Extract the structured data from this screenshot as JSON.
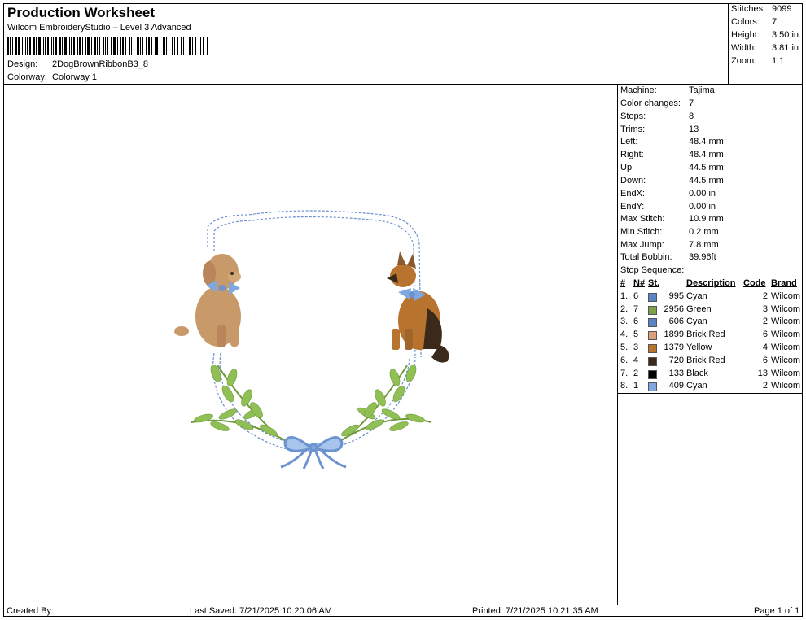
{
  "header": {
    "title": "Production Worksheet",
    "software": "Wilcom EmbroideryStudio – Level 3 Advanced",
    "design_label": "Design:",
    "design_value": "2DogBrownRibbonB3_8",
    "colorway_label": "Colorway:",
    "colorway_value": "Colorway 1"
  },
  "summary": [
    {
      "label": "Stitches:",
      "value": "9099"
    },
    {
      "label": "Colors:",
      "value": "7"
    },
    {
      "label": "Height:",
      "value": "3.50 in"
    },
    {
      "label": "Width:",
      "value": "3.81 in"
    },
    {
      "label": "Zoom:",
      "value": "1:1"
    }
  ],
  "machine_info": [
    {
      "label": "Machine:",
      "value": "Tajima"
    },
    {
      "label": "Color changes:",
      "value": "7"
    },
    {
      "label": "Stops:",
      "value": "8"
    },
    {
      "label": "Trims:",
      "value": "13"
    },
    {
      "label": "Left:",
      "value": "48.4 mm"
    },
    {
      "label": "Right:",
      "value": "48.4 mm"
    },
    {
      "label": "Up:",
      "value": "44.5 mm"
    },
    {
      "label": "Down:",
      "value": "44.5 mm"
    },
    {
      "label": "EndX:",
      "value": "0.00 in"
    },
    {
      "label": "EndY:",
      "value": "0.00 in"
    },
    {
      "label": "Max Stitch:",
      "value": "10.9 mm"
    },
    {
      "label": "Min Stitch:",
      "value": "0.2 mm"
    },
    {
      "label": "Max Jump:",
      "value": "7.8 mm"
    },
    {
      "label": "Total Bobbin:",
      "value": "39.96ft"
    }
  ],
  "stop_sequence": {
    "title": "Stop Sequence:",
    "headers": [
      "#",
      "N#",
      "St.",
      "Description",
      "Code",
      "Brand"
    ],
    "rows": [
      {
        "num": "1.",
        "n": "6",
        "color": "#5a84c4",
        "st": "995",
        "desc": "Cyan",
        "code": "2",
        "brand": "Wilcom"
      },
      {
        "num": "2.",
        "n": "7",
        "color": "#7fa04a",
        "st": "2956",
        "desc": "Green",
        "code": "3",
        "brand": "Wilcom"
      },
      {
        "num": "3.",
        "n": "6",
        "color": "#5a84c4",
        "st": "606",
        "desc": "Cyan",
        "code": "2",
        "brand": "Wilcom"
      },
      {
        "num": "4.",
        "n": "5",
        "color": "#d9a07a",
        "st": "1899",
        "desc": "Brick Red",
        "code": "6",
        "brand": "Wilcom"
      },
      {
        "num": "5.",
        "n": "3",
        "color": "#b8732f",
        "st": "1379",
        "desc": "Yellow",
        "code": "4",
        "brand": "Wilcom"
      },
      {
        "num": "6.",
        "n": "4",
        "color": "#3b2a1c",
        "st": "720",
        "desc": "Brick Red",
        "code": "6",
        "brand": "Wilcom"
      },
      {
        "num": "7.",
        "n": "2",
        "color": "#000000",
        "st": "133",
        "desc": "Black",
        "code": "13",
        "brand": "Wilcom"
      },
      {
        "num": "8.",
        "n": "1",
        "color": "#7fa8e0",
        "st": "409",
        "desc": "Cyan",
        "code": "2",
        "brand": "Wilcom"
      }
    ]
  },
  "footer": {
    "created_by": "Created By:",
    "last_saved": "Last Saved: 7/21/2025 10:20:06 AM",
    "printed": "Printed: 7/21/2025 10:21:35 AM",
    "page": "Page 1 of 1"
  },
  "colors": {
    "frame_stitch": "#6a8ed0",
    "leaf": "#8fbf55",
    "ribbon": "#7fa8e0",
    "dog_tan": "#c89a6a",
    "dog_brown": "#8a5a2c"
  }
}
